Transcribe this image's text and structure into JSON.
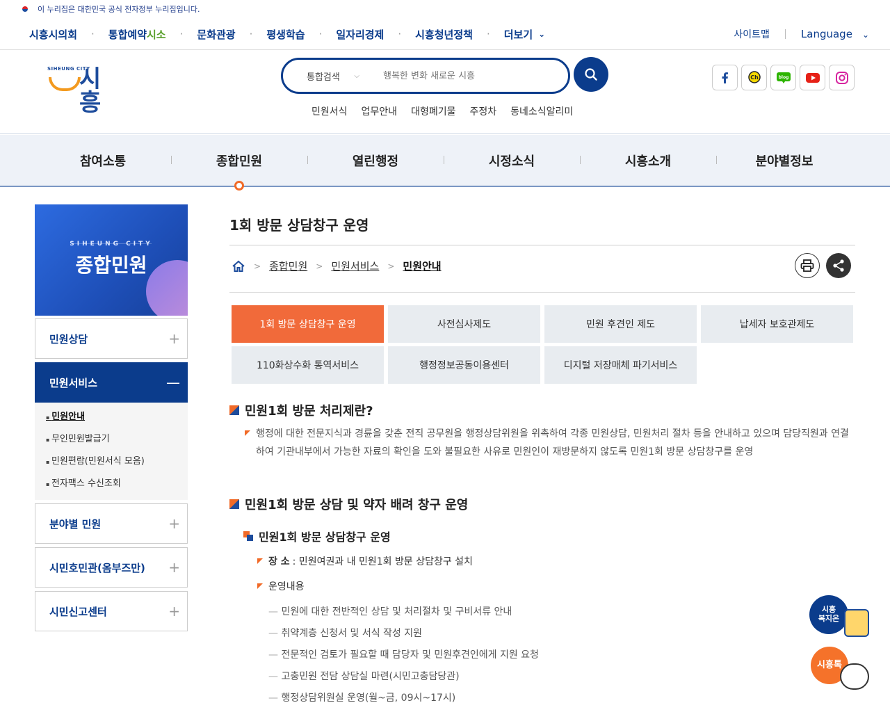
{
  "gov_banner": "이 누리집은 대한민국 공식 전자정부 누리집입니다.",
  "util_nav": {
    "items": [
      {
        "label": "시흥시의회"
      },
      {
        "label_a": "통합예약",
        "label_b": "시소"
      },
      {
        "label": "문화관광"
      },
      {
        "label": "평생학습"
      },
      {
        "label": "일자리경제"
      },
      {
        "label": "시흥청년정책"
      },
      {
        "label": "더보기"
      }
    ],
    "sitemap": "사이트맵",
    "language": "Language"
  },
  "logo": {
    "small": "SIHEUNG CITY",
    "big": "시흥"
  },
  "search": {
    "scope": "통합검색",
    "placeholder": "행복한 변화 새로운 시흥"
  },
  "quick_links": [
    "민원서식",
    "업무안내",
    "대형폐기물",
    "주정차",
    "동네소식알리미"
  ],
  "sns": [
    "facebook-icon",
    "kakao-channel-icon",
    "blog-icon",
    "youtube-icon",
    "instagram-icon"
  ],
  "gnb": [
    "참여소통",
    "종합민원",
    "열린행정",
    "시정소식",
    "시흥소개",
    "분야별정보"
  ],
  "sidebar": {
    "banner_sub": "SIHEUNG CITY",
    "banner_title": "종합민원",
    "items": [
      {
        "label": "민원상담"
      },
      {
        "label": "민원서비스"
      },
      {
        "label": "분야별 민원"
      },
      {
        "label": "시민호민관(옴부즈만)"
      },
      {
        "label": "시민신고센터"
      }
    ],
    "sub_items": [
      "민원안내",
      "무인민원발급기",
      "민원편람(민원서식 모음)",
      "전자팩스 수신조회"
    ]
  },
  "content": {
    "title": "1회 방문 상담창구 운영",
    "breadcrumb": [
      "종합민원",
      "민원서비스",
      "민원안내"
    ],
    "tabs": [
      "1회 방문 상담창구 운영",
      "사전심사제도",
      "민원 후견인 제도",
      "납세자 보호관제도",
      "110화상수화 통역서비스",
      "행정정보공동이용센터",
      "디지털 저장매체 파기서비스"
    ],
    "section1_title": "민원1회 방문 처리제란?",
    "section1_desc": "행정에 대한 전문지식과 경륜을 갖춘 전직 공무원을 행정상담위원을 위촉하여 각종 민원상담, 민원처리 절차 등을 안내하고 있으며 담당직원과 연결하여 기관내부에서 가능한 자료의 확인을 도와 불필요한 사유로 민원인이 재방문하지 않도록 민원1회 방문 상담창구를 운영",
    "section2_title": "민원1회 방문 상담 및 약자 배려 창구 운영",
    "sub_title": "민원1회 방문 상담창구 운영",
    "place_label": "장 소",
    "place_value": ": 민원여권과 내 민원1회 방문 상담창구 설치",
    "ops_label": "운영내용",
    "ops_items": [
      "민원에 대한 전반적인 상담 및 처리절차 및 구비서류 안내",
      "취약계층 신청서 및 서식 작성 지원",
      "전문적인 검토가 필요할 때 담당자 및 민원후견인에게 지원 요청",
      "고충민원 전담 상담실 마련(시민고충담당관)",
      "행정상담위원실 운영(월~금, 09시~17시)"
    ]
  },
  "floating": {
    "welfare": "시흥\n복지온",
    "talk": "시흥톡"
  }
}
